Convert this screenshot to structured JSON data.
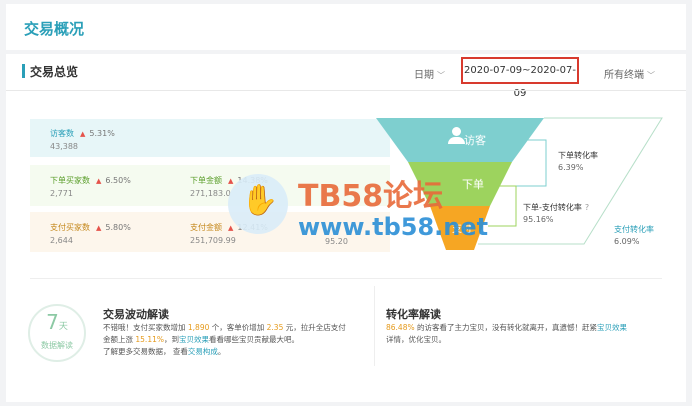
{
  "header": {
    "title": "交易概况"
  },
  "section": {
    "title": "交易总览",
    "date_label": "日期",
    "date_range": "2020-07-09~2020-07-09",
    "terminal": "所有终端"
  },
  "rows": {
    "visitors": {
      "name": "访客数",
      "pct": "5.31%",
      "value": "43,388"
    },
    "order_buyers": {
      "name": "下单买家数",
      "pct": "6.50%",
      "value": "2,771"
    },
    "order_amount": {
      "name": "下单金额",
      "pct": "14.38%",
      "value": "271,183.0"
    },
    "pay_buyers": {
      "name": "支付买家数",
      "pct": "5.80%",
      "value": "2,644"
    },
    "pay_amount": {
      "name": "支付金额",
      "pct": "12.41%",
      "value": "251,709.99"
    },
    "unit_price": {
      "value": "95.20"
    }
  },
  "funnel": {
    "visitor_label": "访客",
    "order_label": "下单",
    "pay_label": "支付",
    "colors": {
      "visitor": "#7ecfcf",
      "order": "#9dd35e",
      "pay": "#f6a623"
    }
  },
  "conversions": {
    "order_rate": {
      "label": "下单转化率",
      "value": "6.39%"
    },
    "order_pay_rate": {
      "label": "下单-支付转化率",
      "value": "95.16%"
    },
    "pay_rate": {
      "label": "支付转化率",
      "value": "6.09%"
    }
  },
  "badge": {
    "number": "7",
    "unit": "天",
    "text": "数据解读"
  },
  "fluctuation": {
    "title": "交易波动解读",
    "line1_a": "不错哦！支付买家数增加",
    "line1_n1": "1,890",
    "line1_b": "个，客单价增加",
    "line1_n2": "2.35",
    "line1_c": "元，拉升全店支付",
    "line2_a": "金额上涨",
    "line2_n": "15.11%",
    "line2_b": "，到",
    "line2_link": "宝贝效果",
    "line2_c": "看看哪些宝贝贡献最大吧。",
    "line3_a": "了解更多交易数据，",
    "line3_b": "查看",
    "line3_link": "交易构成",
    "line3_c": "。"
  },
  "conversion_read": {
    "title": "转化率解读",
    "line1_n": "86.48%",
    "line1_a": "的访客看了主力宝贝，没有转化就离开，真遗憾！赶紧",
    "line1_link": "宝贝效果",
    "line2": "详情，优化宝贝。"
  },
  "watermark": {
    "text": "TB58论坛",
    "url": "www.tb58.net"
  }
}
